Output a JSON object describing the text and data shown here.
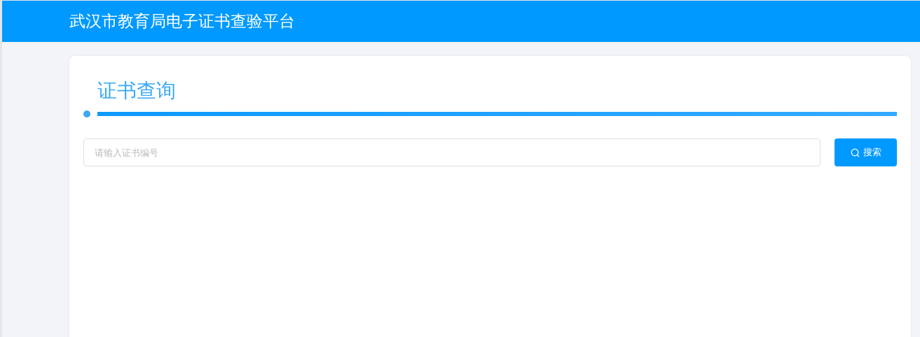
{
  "header": {
    "title": "武汉市教育局电子证书查验平台"
  },
  "panel": {
    "title": "证书查询"
  },
  "search": {
    "placeholder": "请输入证书编号",
    "button": "搜索"
  }
}
